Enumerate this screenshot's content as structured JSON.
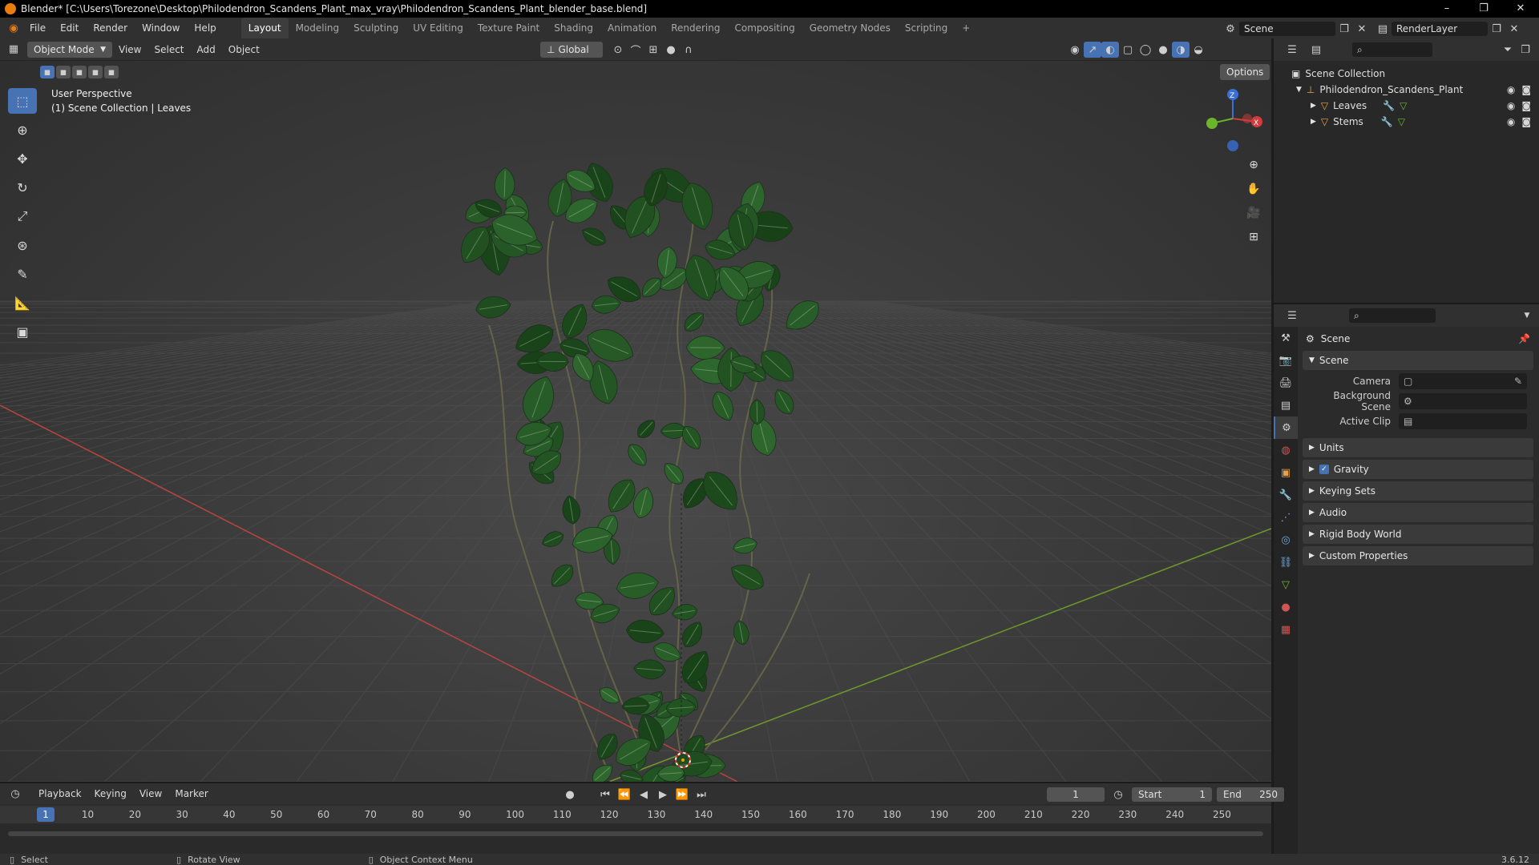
{
  "window": {
    "title": "Blender* [C:\\Users\\Torezone\\Desktop\\Philodendron_Scandens_Plant_max_vray\\Philodendron_Scandens_Plant_blender_base.blend]",
    "minimize": "–",
    "maximize": "❐",
    "close": "✕"
  },
  "menu": [
    "File",
    "Edit",
    "Render",
    "Window",
    "Help"
  ],
  "workspaces": [
    {
      "label": "Layout",
      "active": true
    },
    {
      "label": "Modeling"
    },
    {
      "label": "Sculpting"
    },
    {
      "label": "UV Editing"
    },
    {
      "label": "Texture Paint"
    },
    {
      "label": "Shading"
    },
    {
      "label": "Animation"
    },
    {
      "label": "Rendering"
    },
    {
      "label": "Compositing"
    },
    {
      "label": "Geometry Nodes"
    },
    {
      "label": "Scripting"
    }
  ],
  "add_workspace": "+",
  "scene_selector": {
    "value": "Scene"
  },
  "render_layer": {
    "value": "RenderLayer"
  },
  "viewport_header": {
    "mode": "Object Mode",
    "items": [
      "View",
      "Select",
      "Add",
      "Object"
    ],
    "orientation": "Global",
    "options": "Options"
  },
  "viewport": {
    "perspective": "User Perspective",
    "collection_info": "(1) Scene Collection | Leaves",
    "gizmo": {
      "z": "Z",
      "x": "X"
    }
  },
  "outliner": {
    "root": "Scene Collection",
    "collection": "Philodendron_Scandens_Plant",
    "objects": [
      "Leaves",
      "Stems"
    ]
  },
  "properties": {
    "context": "Scene",
    "panel_open": "Scene",
    "fields": [
      {
        "label": "Camera"
      },
      {
        "label": "Background Scene"
      },
      {
        "label": "Active Clip"
      }
    ],
    "panels": [
      "Units",
      "Gravity",
      "Keying Sets",
      "Audio",
      "Rigid Body World",
      "Custom Properties"
    ],
    "gravity_checked": true
  },
  "timeline": {
    "menus": [
      "Playback",
      "Keying",
      "View",
      "Marker"
    ],
    "current_frame": "1",
    "start_label": "Start",
    "start": "1",
    "end_label": "End",
    "end": "250",
    "ticks": [
      "1",
      "10",
      "20",
      "30",
      "40",
      "50",
      "60",
      "70",
      "80",
      "90",
      "100",
      "110",
      "120",
      "130",
      "140",
      "150",
      "160",
      "170",
      "180",
      "190",
      "200",
      "210",
      "220",
      "230",
      "240",
      "250"
    ]
  },
  "statusbar": {
    "select": "Select",
    "rotate": "Rotate View",
    "context_menu": "Object Context Menu",
    "version": "3.6.12"
  },
  "colors": {
    "accent": "#4772b3",
    "x_axis": "#c0392b",
    "y_axis": "#6e9a2a",
    "leaf": "#2f4a30"
  }
}
